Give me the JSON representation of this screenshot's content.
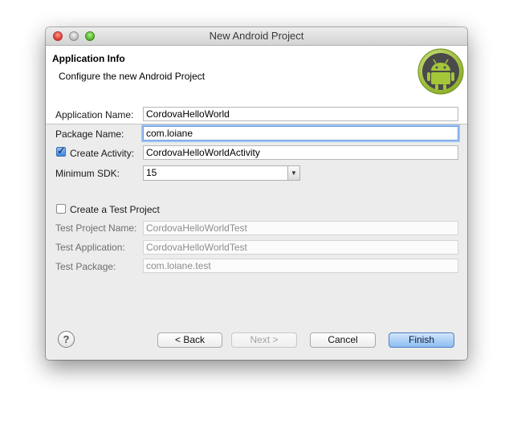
{
  "window": {
    "title": "New Android Project"
  },
  "header": {
    "title": "Application Info",
    "description": "Configure the new Android Project"
  },
  "form": {
    "application_name_label": "Application Name:",
    "application_name_value": "CordovaHelloWorld",
    "package_name_label": "Package Name:",
    "package_name_value": "com.loiane",
    "create_activity_label": "Create Activity:",
    "create_activity_checked": true,
    "create_activity_value": "CordovaHelloWorldActivity",
    "minimum_sdk_label": "Minimum SDK:",
    "minimum_sdk_value": "15",
    "create_test_project_label": "Create a Test Project",
    "create_test_project_checked": false,
    "test_project_name_label": "Test Project Name:",
    "test_project_name_value": "CordovaHelloWorldTest",
    "test_application_label": "Test Application:",
    "test_application_value": "CordovaHelloWorldTest",
    "test_package_label": "Test Package:",
    "test_package_value": "com.loiane.test"
  },
  "footer": {
    "back_label": "< Back",
    "next_label": "Next >",
    "cancel_label": "Cancel",
    "finish_label": "Finish"
  },
  "icons": {
    "help": "help-icon",
    "logo": "android-logo",
    "checkmark": "checkmark-icon",
    "dropdown": "chevron-down-icon"
  },
  "colors": {
    "focus_ring": "#9fc3f3",
    "default_button": "#8bbdf2",
    "android_green": "#a4c639"
  }
}
